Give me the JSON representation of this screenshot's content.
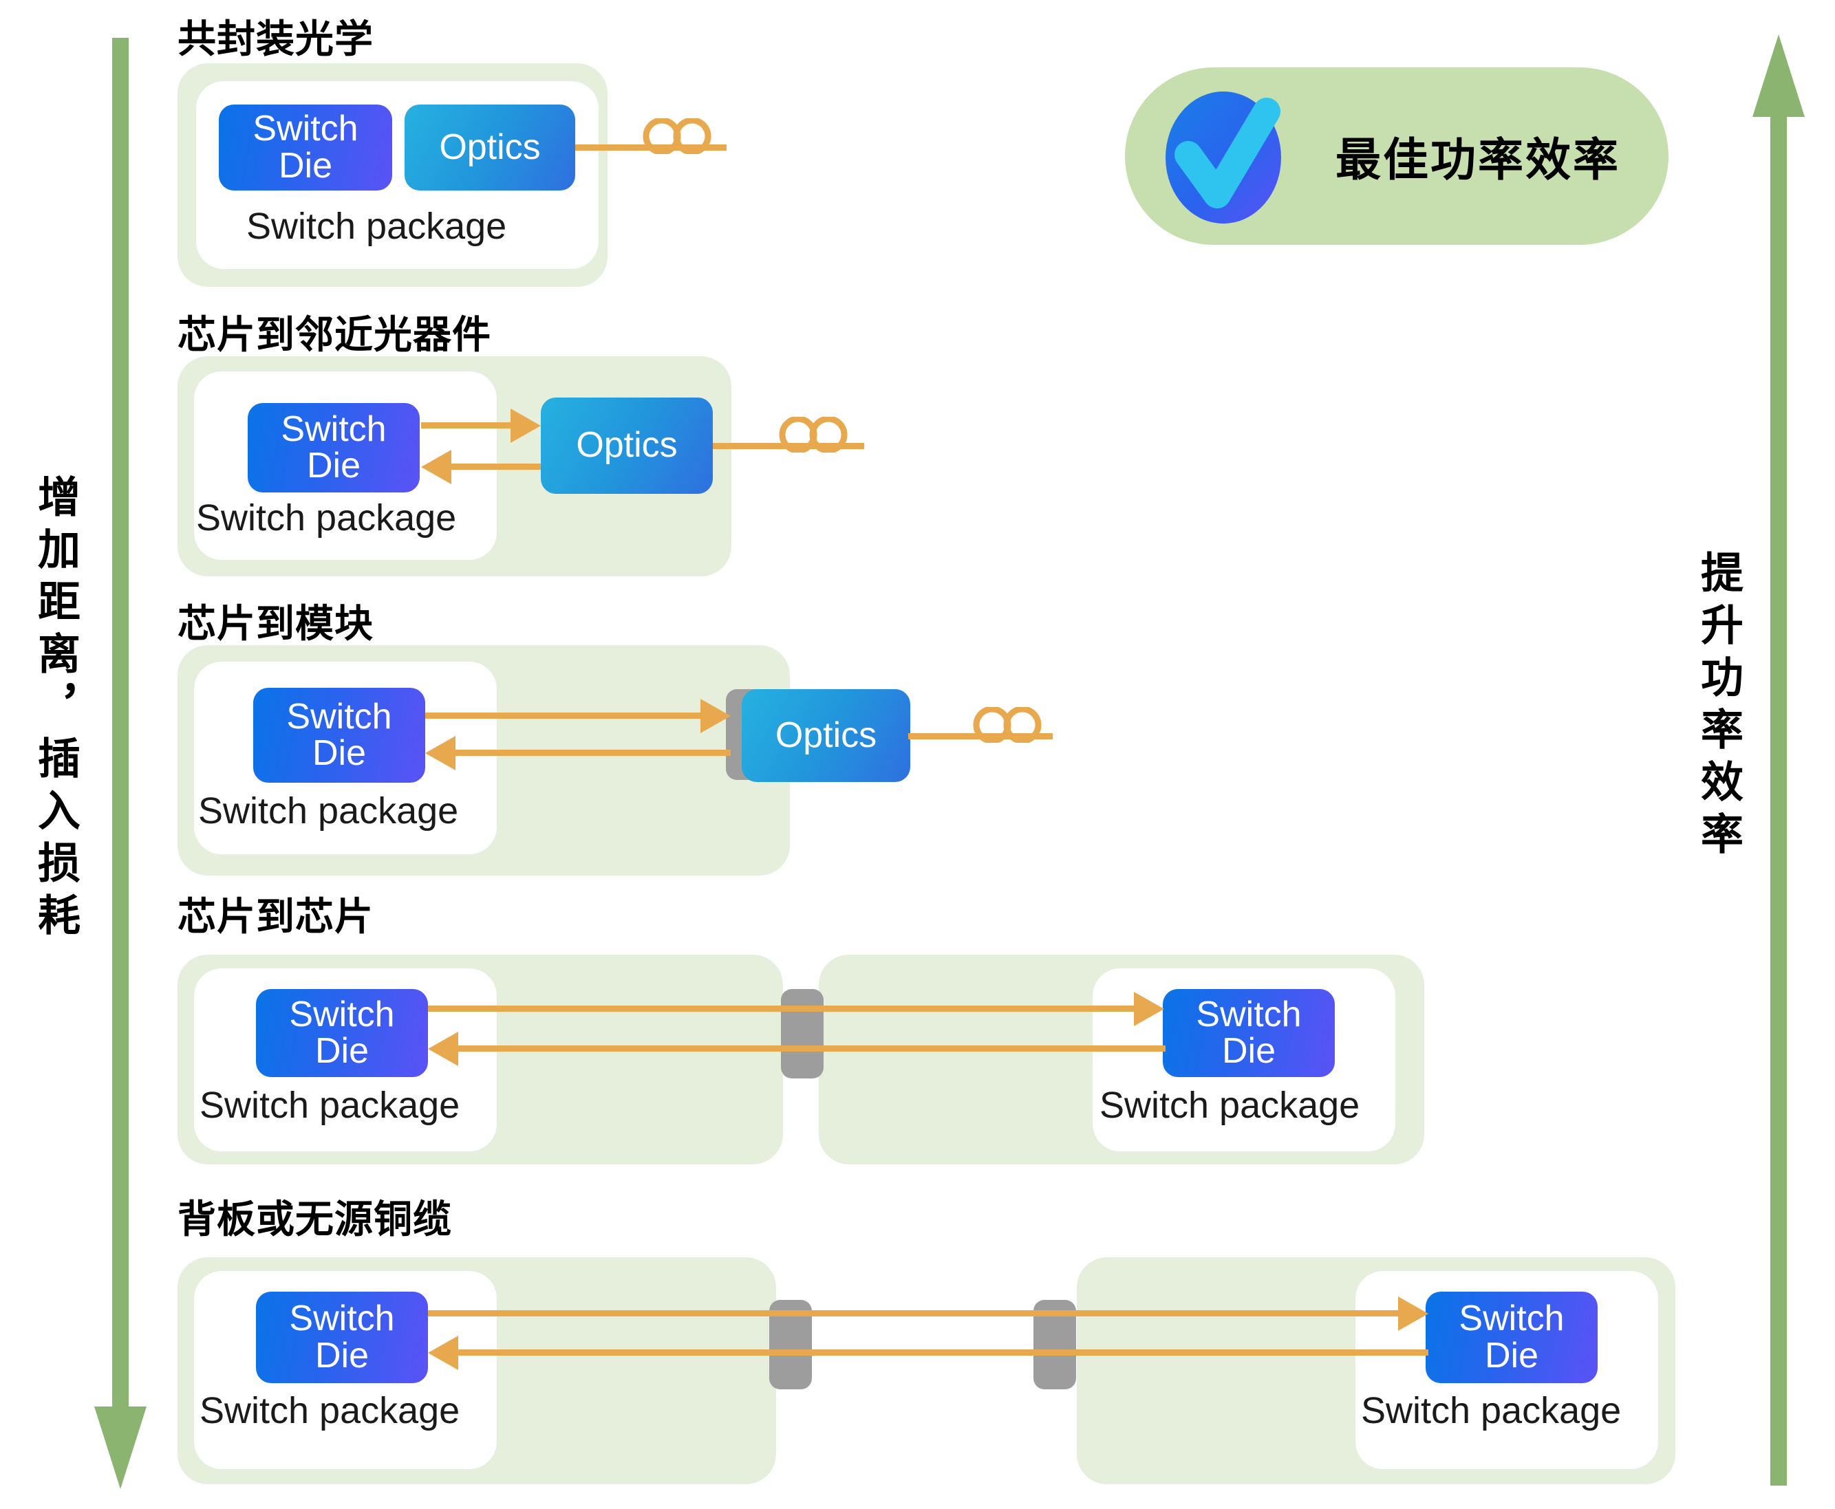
{
  "axes": {
    "left": {
      "label": "增加距离，插入损耗",
      "direction": "down",
      "color": "#8cb471"
    },
    "right": {
      "label": "提升功率效率",
      "direction": "up",
      "color": "#8cb471"
    }
  },
  "badge": {
    "label": "最佳功率效率",
    "icon": "check-circle-icon",
    "bg_color": "#c7dfae",
    "circle_color": "#2f6fe0",
    "check_color": "#2fc4f0"
  },
  "common": {
    "switch_die_label": "Switch\nDie",
    "optics_label": "Optics",
    "switch_package_label": "Switch package",
    "panel_color": "#e6efdc",
    "card_color": "#ffffff",
    "signal_color": "#e8a94e",
    "connector_color": "#9d9d9d",
    "die_gradient": "#0a74e8 → #5b52f5",
    "optics_gradient": "#26b1e0 → #2f6fe0"
  },
  "rows": [
    {
      "id": "co-packaged-optics",
      "title": "共封装光学",
      "has_optics": true,
      "has_fiber": true,
      "connectors": 0,
      "packages": 1
    },
    {
      "id": "chip-to-near-package-optics",
      "title": "芯片到邻近光器件",
      "has_optics": true,
      "has_fiber": true,
      "connectors": 0,
      "packages": 1
    },
    {
      "id": "chip-to-module",
      "title": "芯片到模块",
      "has_optics": true,
      "has_fiber": true,
      "connectors": 1,
      "packages": 1
    },
    {
      "id": "chip-to-chip",
      "title": "芯片到芯片",
      "has_optics": false,
      "has_fiber": false,
      "connectors": 1,
      "packages": 2
    },
    {
      "id": "backplane-or-passive-copper",
      "title": "背板或无源铜缆",
      "has_optics": false,
      "has_fiber": false,
      "connectors": 2,
      "packages": 2
    }
  ]
}
